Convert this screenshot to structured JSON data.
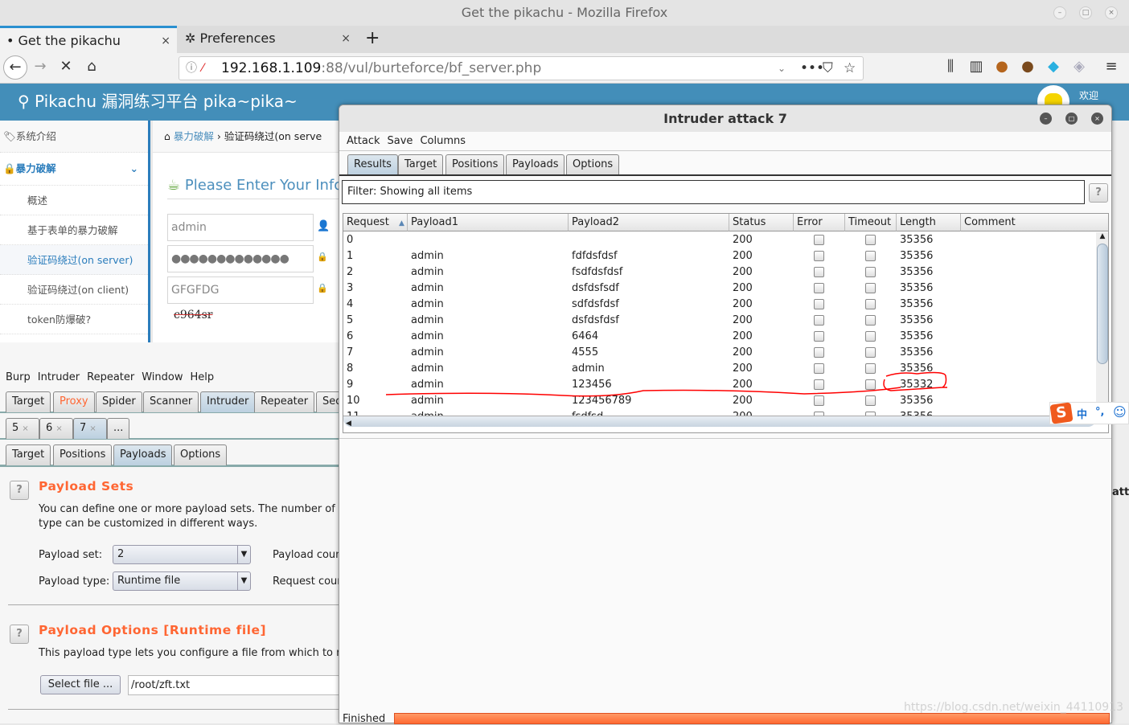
{
  "browser": {
    "window_title": "Get the pikachu - Mozilla Firefox",
    "tabs": [
      {
        "label": "Get the pikachu",
        "close": "×"
      },
      {
        "label": "Preferences",
        "close": "×"
      }
    ],
    "new_tab": "+",
    "url_host": "192.168.1.109",
    "url_rest": ":88/vul/burteforce/bf_server.php"
  },
  "pikachu": {
    "header_title": "Pikachu 漏洞练习平台 pika~pika~",
    "welcome": "欢迎",
    "sidebar": {
      "intro": "系统介绍",
      "section": "暴力破解",
      "items": [
        "概述",
        "基于表单的暴力破解",
        "验证码绕过(on server)",
        "验证码绕过(on client)",
        "token防爆破?"
      ],
      "active_index": 2
    },
    "breadcrumb": {
      "parent": "暴力破解",
      "current": "验证码绕过(on serve"
    },
    "form": {
      "heading": "Please Enter Your Info",
      "username": "admin",
      "password_mask": "●●●●●●●●●●●●●",
      "vcode": "GFGFDG",
      "captcha": "c964sr"
    }
  },
  "burp": {
    "menu": [
      "Burp",
      "Intruder",
      "Repeater",
      "Window",
      "Help"
    ],
    "tabs": [
      "Target",
      "Proxy",
      "Spider",
      "Scanner",
      "Intruder",
      "Repeater",
      "Seq"
    ],
    "active_tab": "Intruder",
    "highlight_tab": "Proxy",
    "attack_tabs": [
      "5",
      "6",
      "7",
      "..."
    ],
    "sub_tabs": [
      "Target",
      "Positions",
      "Payloads",
      "Options"
    ],
    "active_sub_tab": "Payloads",
    "payload_sets": {
      "title": "Payload Sets",
      "desc_line1": "You can define one or more payload sets. The number of pay",
      "desc_line2": "type can be customized in different ways.",
      "set_label": "Payload set:",
      "set_value": "2",
      "type_label": "Payload type:",
      "type_value": "Runtime file",
      "count_label": "Payload coun",
      "request_label": "Request coun"
    },
    "payload_options": {
      "title": "Payload Options [Runtime file]",
      "desc": "This payload type lets you configure a file from which to read",
      "select_button": "Select file ...",
      "file_path": "/root/zft.txt"
    },
    "help": "?",
    "right_edge_text": "atta"
  },
  "intruder": {
    "title": "Intruder attack 7",
    "menu": [
      "Attack",
      "Save",
      "Columns"
    ],
    "tabs": [
      "Results",
      "Target",
      "Positions",
      "Payloads",
      "Options"
    ],
    "active_tab": "Results",
    "filter": "Filter: Showing all items",
    "columns": [
      "Request",
      "Payload1",
      "Payload2",
      "Status",
      "Error",
      "Timeout",
      "Length",
      "Comment"
    ],
    "sort_indicator": "▲",
    "rows": [
      {
        "request": "0",
        "payload1": "",
        "payload2": "",
        "status": "200",
        "length": "35356"
      },
      {
        "request": "1",
        "payload1": "admin",
        "payload2": "fdfdsfdsf",
        "status": "200",
        "length": "35356"
      },
      {
        "request": "2",
        "payload1": "admin",
        "payload2": "fsdfdsfdsf",
        "status": "200",
        "length": "35356"
      },
      {
        "request": "3",
        "payload1": "admin",
        "payload2": "dsfdsfsdf",
        "status": "200",
        "length": "35356"
      },
      {
        "request": "4",
        "payload1": "admin",
        "payload2": "sdfdsfdsf",
        "status": "200",
        "length": "35356"
      },
      {
        "request": "5",
        "payload1": "admin",
        "payload2": "dsfdsfdsf",
        "status": "200",
        "length": "35356"
      },
      {
        "request": "6",
        "payload1": "admin",
        "payload2": "6464",
        "status": "200",
        "length": "35356"
      },
      {
        "request": "7",
        "payload1": "admin",
        "payload2": "4555",
        "status": "200",
        "length": "35356"
      },
      {
        "request": "8",
        "payload1": "admin",
        "payload2": "admin",
        "status": "200",
        "length": "35356"
      },
      {
        "request": "9",
        "payload1": "admin",
        "payload2": "123456",
        "status": "200",
        "length": "35332"
      },
      {
        "request": "10",
        "payload1": "admin",
        "payload2": "123456789",
        "status": "200",
        "length": "35356"
      },
      {
        "request": "11",
        "payload1": "admin",
        "payload2": "fsdfsd",
        "status": "200",
        "length": "35356"
      }
    ],
    "status_text": "Finished",
    "progress_percent": 100,
    "annotation_color": "#ff0000"
  },
  "ime": {
    "zh": "中",
    "punct": "°,"
  },
  "watermark": "https://blog.csdn.net/weixin_44110913",
  "colors": {
    "pikachu_blue": "#438eb9",
    "burp_orange": "#ff6633",
    "progress": "#ff6a33"
  }
}
